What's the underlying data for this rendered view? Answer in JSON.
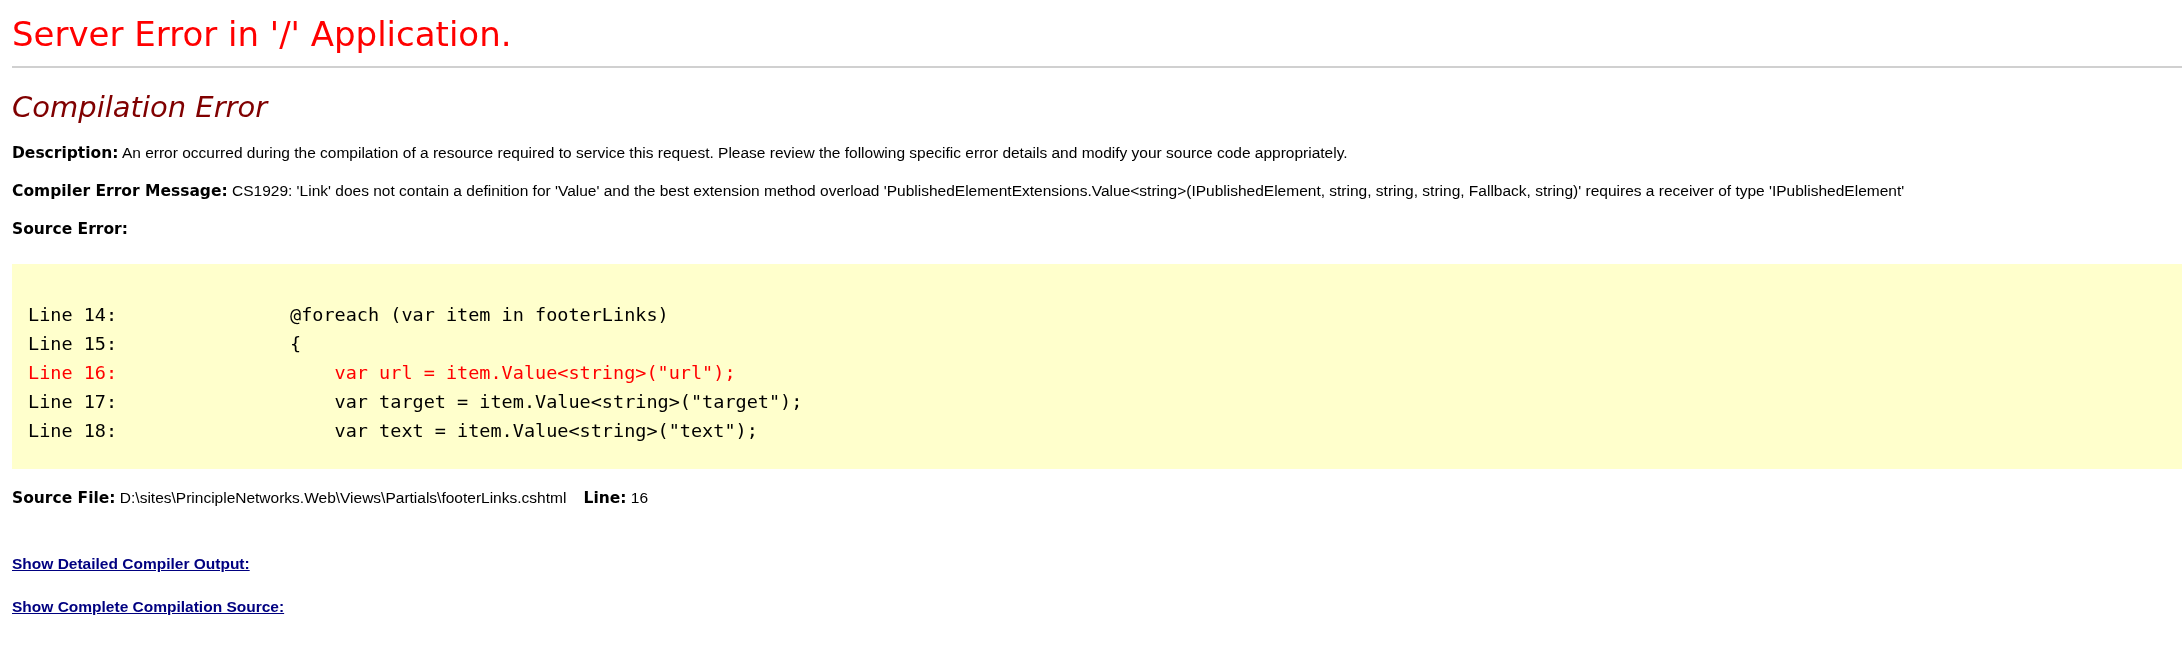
{
  "title": "Server Error in '/' Application.",
  "heading": "Compilation Error",
  "fields": [
    {
      "label": "Description:",
      "value": "An error occurred during the compilation of a resource required to service this request. Please review the following specific error details and modify your source code appropriately."
    },
    {
      "label": "Compiler Error Message:",
      "value": "CS1929: 'Link' does not contain a definition for 'Value' and the best extension method overload 'PublishedElementExtensions.Value<string>(IPublishedElement, string, string, string, Fallback, string)' requires a receiver of type 'IPublishedElement'"
    }
  ],
  "source_error": {
    "label": "Source Error:",
    "lines": [
      {
        "number": "Line 14:",
        "code": "@foreach (var item in footerLinks)",
        "error": false
      },
      {
        "number": "Line 15:",
        "code": "{",
        "error": false
      },
      {
        "number": "Line 16:",
        "code": "    var url = item.Value<string>(\"url\");",
        "error": true
      },
      {
        "number": "Line 17:",
        "code": "    var target = item.Value<string>(\"target\");",
        "error": false
      },
      {
        "number": "Line 18:",
        "code": "    var text = item.Value<string>(\"text\");",
        "error": false
      }
    ]
  },
  "source_file": {
    "label": "Source File:",
    "value": "D:\\sites\\PrincipleNetworks.Web\\Views\\Partials\\footerLinks.cshtml",
    "line_label": "Line:",
    "line_value": "16"
  },
  "links": [
    "Show Detailed Compiler Output:",
    "Show Complete Compilation Source:"
  ]
}
